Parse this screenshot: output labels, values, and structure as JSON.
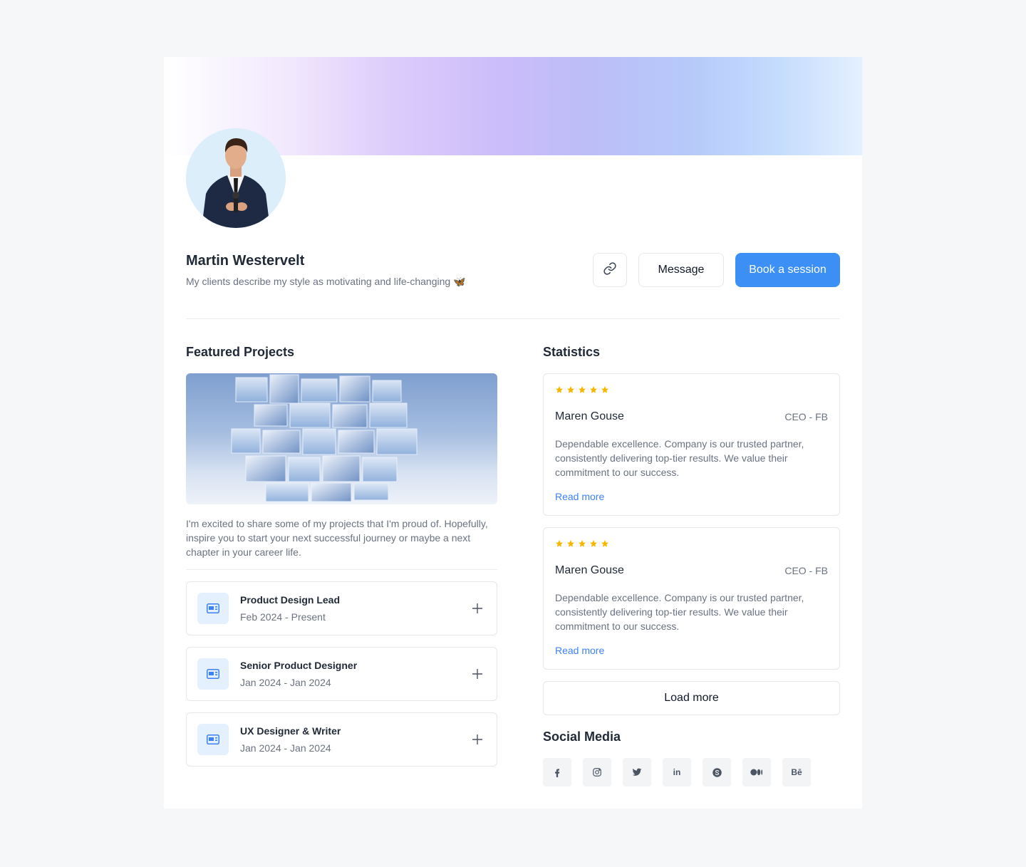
{
  "profile": {
    "name": "Martin Westervelt",
    "bio": "My clients describe my style as motivating and life-changing",
    "bio_emoji": "🦋"
  },
  "actions": {
    "copy_link_icon": "link-icon",
    "message_label": "Message",
    "book_label": "Book a session"
  },
  "featured": {
    "heading": "Featured Projects",
    "description": "I'm excited to share some of my projects that I'm proud of. Hopefully, inspire you to start your next successful journey or maybe a next chapter in your career life.",
    "jobs": [
      {
        "title": "Product Design Lead",
        "dates": "Feb 2024 - Present"
      },
      {
        "title": "Senior Product Designer",
        "dates": "Jan 2024 - Jan 2024"
      },
      {
        "title": "UX Designer & Writer",
        "dates": "Jan 2024 - Jan 2024"
      }
    ]
  },
  "statistics": {
    "heading": "Statistics",
    "reviews": [
      {
        "rating": 5,
        "name": "Maren Gouse",
        "role": "CEO - FB",
        "text": "Dependable excellence. Company is our trusted partner, consistently delivering top-tier results. We value their commitment to our success.",
        "link": "Read more"
      },
      {
        "rating": 5,
        "name": "Maren Gouse",
        "role": "CEO - FB",
        "text": "Dependable excellence. Company is our trusted partner, consistently delivering top-tier results. We value their commitment to our success.",
        "link": "Read more"
      }
    ],
    "load_more": "Load more"
  },
  "social": {
    "heading": "Social Media",
    "icons": [
      "facebook-icon",
      "instagram-icon",
      "twitter-icon",
      "linkedin-icon",
      "skype-icon",
      "medium-icon",
      "behance-icon"
    ],
    "behance_text": "Bē",
    "linkedin_text": "in"
  },
  "colors": {
    "accent": "#3b8ff5",
    "star": "#f5b800",
    "link": "#3b82f6"
  }
}
